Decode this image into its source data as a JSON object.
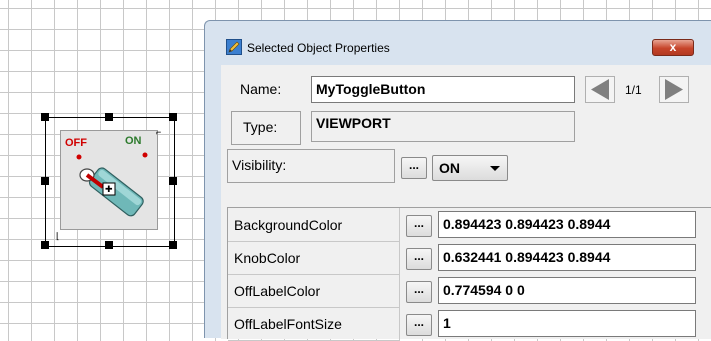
{
  "dialog": {
    "title": "Selected Object Properties",
    "close_label": "x",
    "name_label": "Name:",
    "name_value": "MyToggleButton",
    "counter": "1/1",
    "type_label": "Type:",
    "type_value": "VIEWPORT",
    "visibility_label": "Visibility:",
    "dots_label": "...",
    "visibility_value": "ON",
    "properties": [
      {
        "name": "BackgroundColor",
        "value": "0.894423 0.894423 0.8944"
      },
      {
        "name": "KnobColor",
        "value": "0.632441 0.894423 0.8944"
      },
      {
        "name": "OffLabelColor",
        "value": "0.774594 0 0"
      },
      {
        "name": "OffLabelFontSize",
        "value": "1"
      }
    ]
  },
  "widget": {
    "off_label": "OFF",
    "on_label": "ON"
  },
  "colors": {
    "close_button": "#c7452b",
    "off_label": "#d00000",
    "on_label": "#2c7a2c",
    "knob": "#6fb8b8",
    "dialog_frame": "#d8e3ef"
  },
  "icons": [
    "properties-pencil-icon",
    "close-icon",
    "prev-arrow-icon",
    "next-arrow-icon",
    "move-cursor-icon",
    "dropdown-arrow-icon"
  ]
}
